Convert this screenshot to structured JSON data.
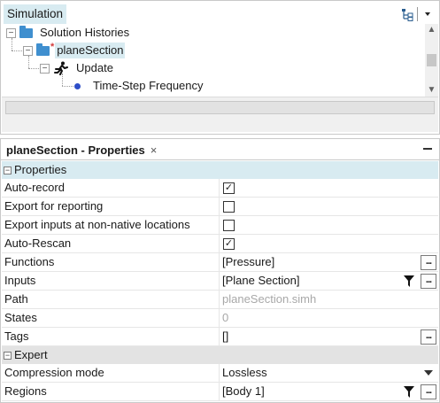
{
  "tree_panel": {
    "title": "Simulation",
    "tools": {
      "hierarchy_icon": "tree-hierarchy-icon",
      "menu_icon": "dropdown-menu-icon"
    },
    "items": [
      {
        "label": "Solution Histories",
        "icon": "folder-icon",
        "expander": "−"
      },
      {
        "label": "planeSection",
        "icon": "folder-icon",
        "expander": "−",
        "modified_mark": "*",
        "selected": true
      },
      {
        "label": "Update",
        "icon": "runner-icon",
        "expander": "−"
      },
      {
        "label": "Time-Step Frequency",
        "icon": "dot-icon"
      }
    ]
  },
  "props_panel": {
    "tab_title": "planeSection - Properties",
    "tab_close": "×",
    "sections": [
      {
        "title": "Properties",
        "toggle": "−",
        "rows": [
          {
            "name": "Auto-record",
            "type": "checkbox",
            "checked": true
          },
          {
            "name": "Export for reporting",
            "type": "checkbox",
            "checked": false
          },
          {
            "name": "Export inputs at non-native locations",
            "type": "checkbox",
            "checked": false
          },
          {
            "name": "Auto-Rescan",
            "type": "checkbox",
            "checked": true
          },
          {
            "name": "Functions",
            "type": "text",
            "value": "[Pressure]",
            "ellipsis": true
          },
          {
            "name": "Inputs",
            "type": "text",
            "value": "[Plane Section]",
            "ellipsis": true,
            "filter": true
          },
          {
            "name": "Path",
            "type": "text",
            "value": "planeSection.simh",
            "disabled": true
          },
          {
            "name": "States",
            "type": "text",
            "value": "0",
            "disabled": true
          },
          {
            "name": "Tags",
            "type": "text",
            "value": "[]",
            "ellipsis": true
          }
        ]
      },
      {
        "title": "Expert",
        "toggle": "−",
        "rows": [
          {
            "name": "Compression mode",
            "type": "dropdown",
            "value": "Lossless"
          },
          {
            "name": "Regions",
            "type": "text",
            "value": "[Body 1]",
            "ellipsis": true,
            "filter": true
          }
        ]
      }
    ],
    "ellipsis_label": "...",
    "check_mark": "✓"
  },
  "colors": {
    "selection": "#d8ebf1",
    "folder": "#3f8fcf",
    "modified_star": "#d23b3b",
    "dot": "#2e4ec8",
    "expert_header": "#e3e3e3"
  }
}
